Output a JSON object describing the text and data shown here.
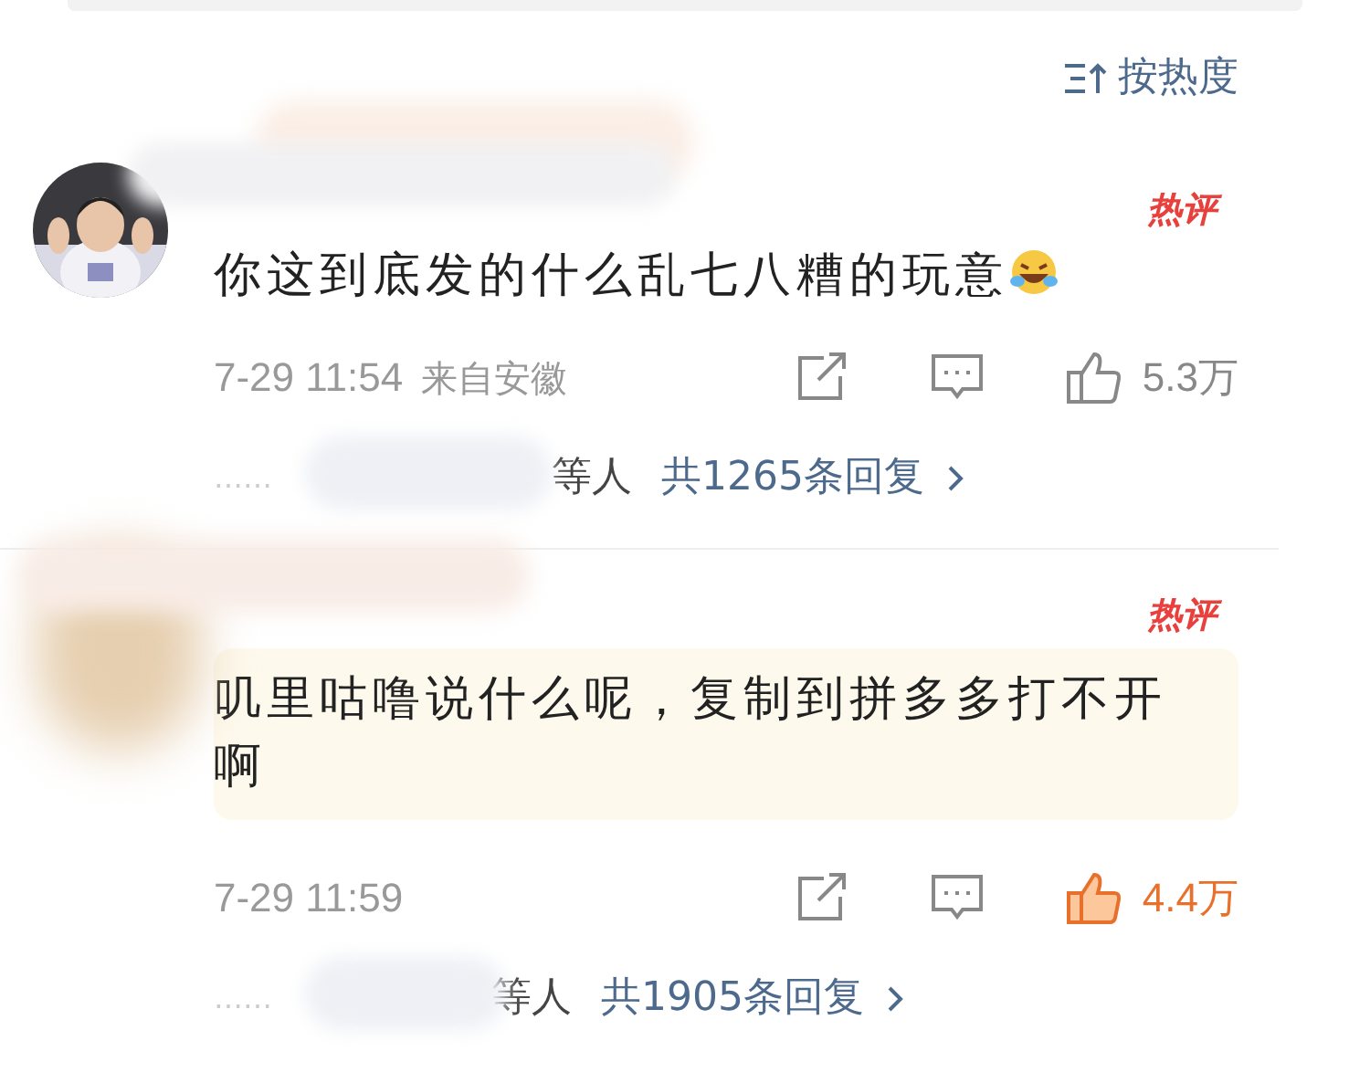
{
  "sort": {
    "label": "按热度"
  },
  "comments": [
    {
      "badge": "热评",
      "text": "你这到底发的什么乱七八糟的玩意",
      "trailing_emoji": true,
      "highlighted": false,
      "time": "7-29 11:54",
      "location": "来自安徽",
      "likes": "5.3万",
      "liked": false,
      "replies": {
        "ellipsis": "……",
        "who": "等人",
        "link": "共1265条回复"
      }
    },
    {
      "badge": "热评",
      "text": "叽里咕噜说什么呢，复制到拼多多打不开啊",
      "trailing_emoji": false,
      "highlighted": true,
      "time": "7-29 11:59",
      "likes": "4.4万",
      "liked": true,
      "replies": {
        "ellipsis": "……",
        "who": "等人",
        "link": "共1905条回复"
      }
    }
  ]
}
